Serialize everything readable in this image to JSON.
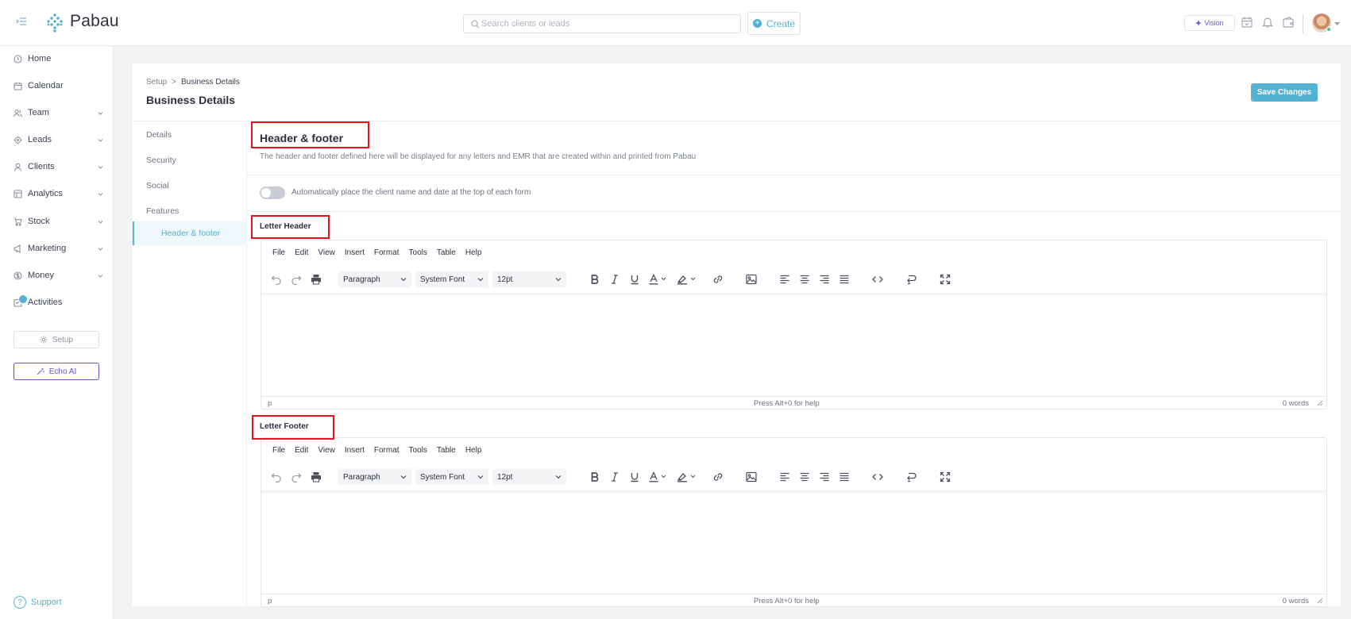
{
  "app": {
    "brand": "Pabau",
    "accent_color": "#54b2d3",
    "ai_color": "#6a4fd1"
  },
  "topbar": {
    "search_placeholder": "Search clients or leads",
    "create_label": "Create",
    "vision_label": "Vision",
    "icons": [
      "calendar-check-icon",
      "bell-icon",
      "wallet-icon"
    ]
  },
  "sidebar": {
    "items": [
      {
        "label": "Home",
        "icon": "home-icon",
        "has_caret": false
      },
      {
        "label": "Calendar",
        "icon": "calendar-icon",
        "has_caret": false
      },
      {
        "label": "Team",
        "icon": "team-icon",
        "has_caret": true
      },
      {
        "label": "Leads",
        "icon": "leads-icon",
        "has_caret": true
      },
      {
        "label": "Clients",
        "icon": "user-icon",
        "has_caret": true
      },
      {
        "label": "Analytics",
        "icon": "analytics-icon",
        "has_caret": true
      },
      {
        "label": "Stock",
        "icon": "cart-icon",
        "has_caret": true
      },
      {
        "label": "Marketing",
        "icon": "megaphone-icon",
        "has_caret": true
      },
      {
        "label": "Money",
        "icon": "money-icon",
        "has_caret": true
      },
      {
        "label": "Activities",
        "icon": "activities-icon",
        "has_caret": false
      }
    ],
    "setup_label": "Setup",
    "echo_label": "Echo AI",
    "support_label": "Support"
  },
  "page": {
    "breadcrumb_root": "Setup",
    "breadcrumb_sep": ">",
    "breadcrumb_current": "Business Details",
    "title": "Business Details",
    "save_label": "Save Changes"
  },
  "subnav": {
    "items": [
      "Details",
      "Security",
      "Social",
      "Features"
    ],
    "active": "Header & footer"
  },
  "section": {
    "title": "Header & footer",
    "description": "The header and footer defined here will be displayed for any letters and EMR that are created within and printed from Pabau",
    "toggle_label": "Automatically place the client name and date at the top of each form",
    "toggle_on": false
  },
  "editors": [
    {
      "label": "Letter Header"
    },
    {
      "label": "Letter Footer"
    }
  ],
  "editor": {
    "menu": [
      "File",
      "Edit",
      "View",
      "Insert",
      "Format",
      "Tools",
      "Table",
      "Help"
    ],
    "block_format": "Paragraph",
    "font_family": "System Font",
    "font_size": "12pt",
    "status_path": "p",
    "status_help": "Press Alt+0 for help",
    "status_words": "0 words"
  },
  "annotation_color": "#e8121e"
}
